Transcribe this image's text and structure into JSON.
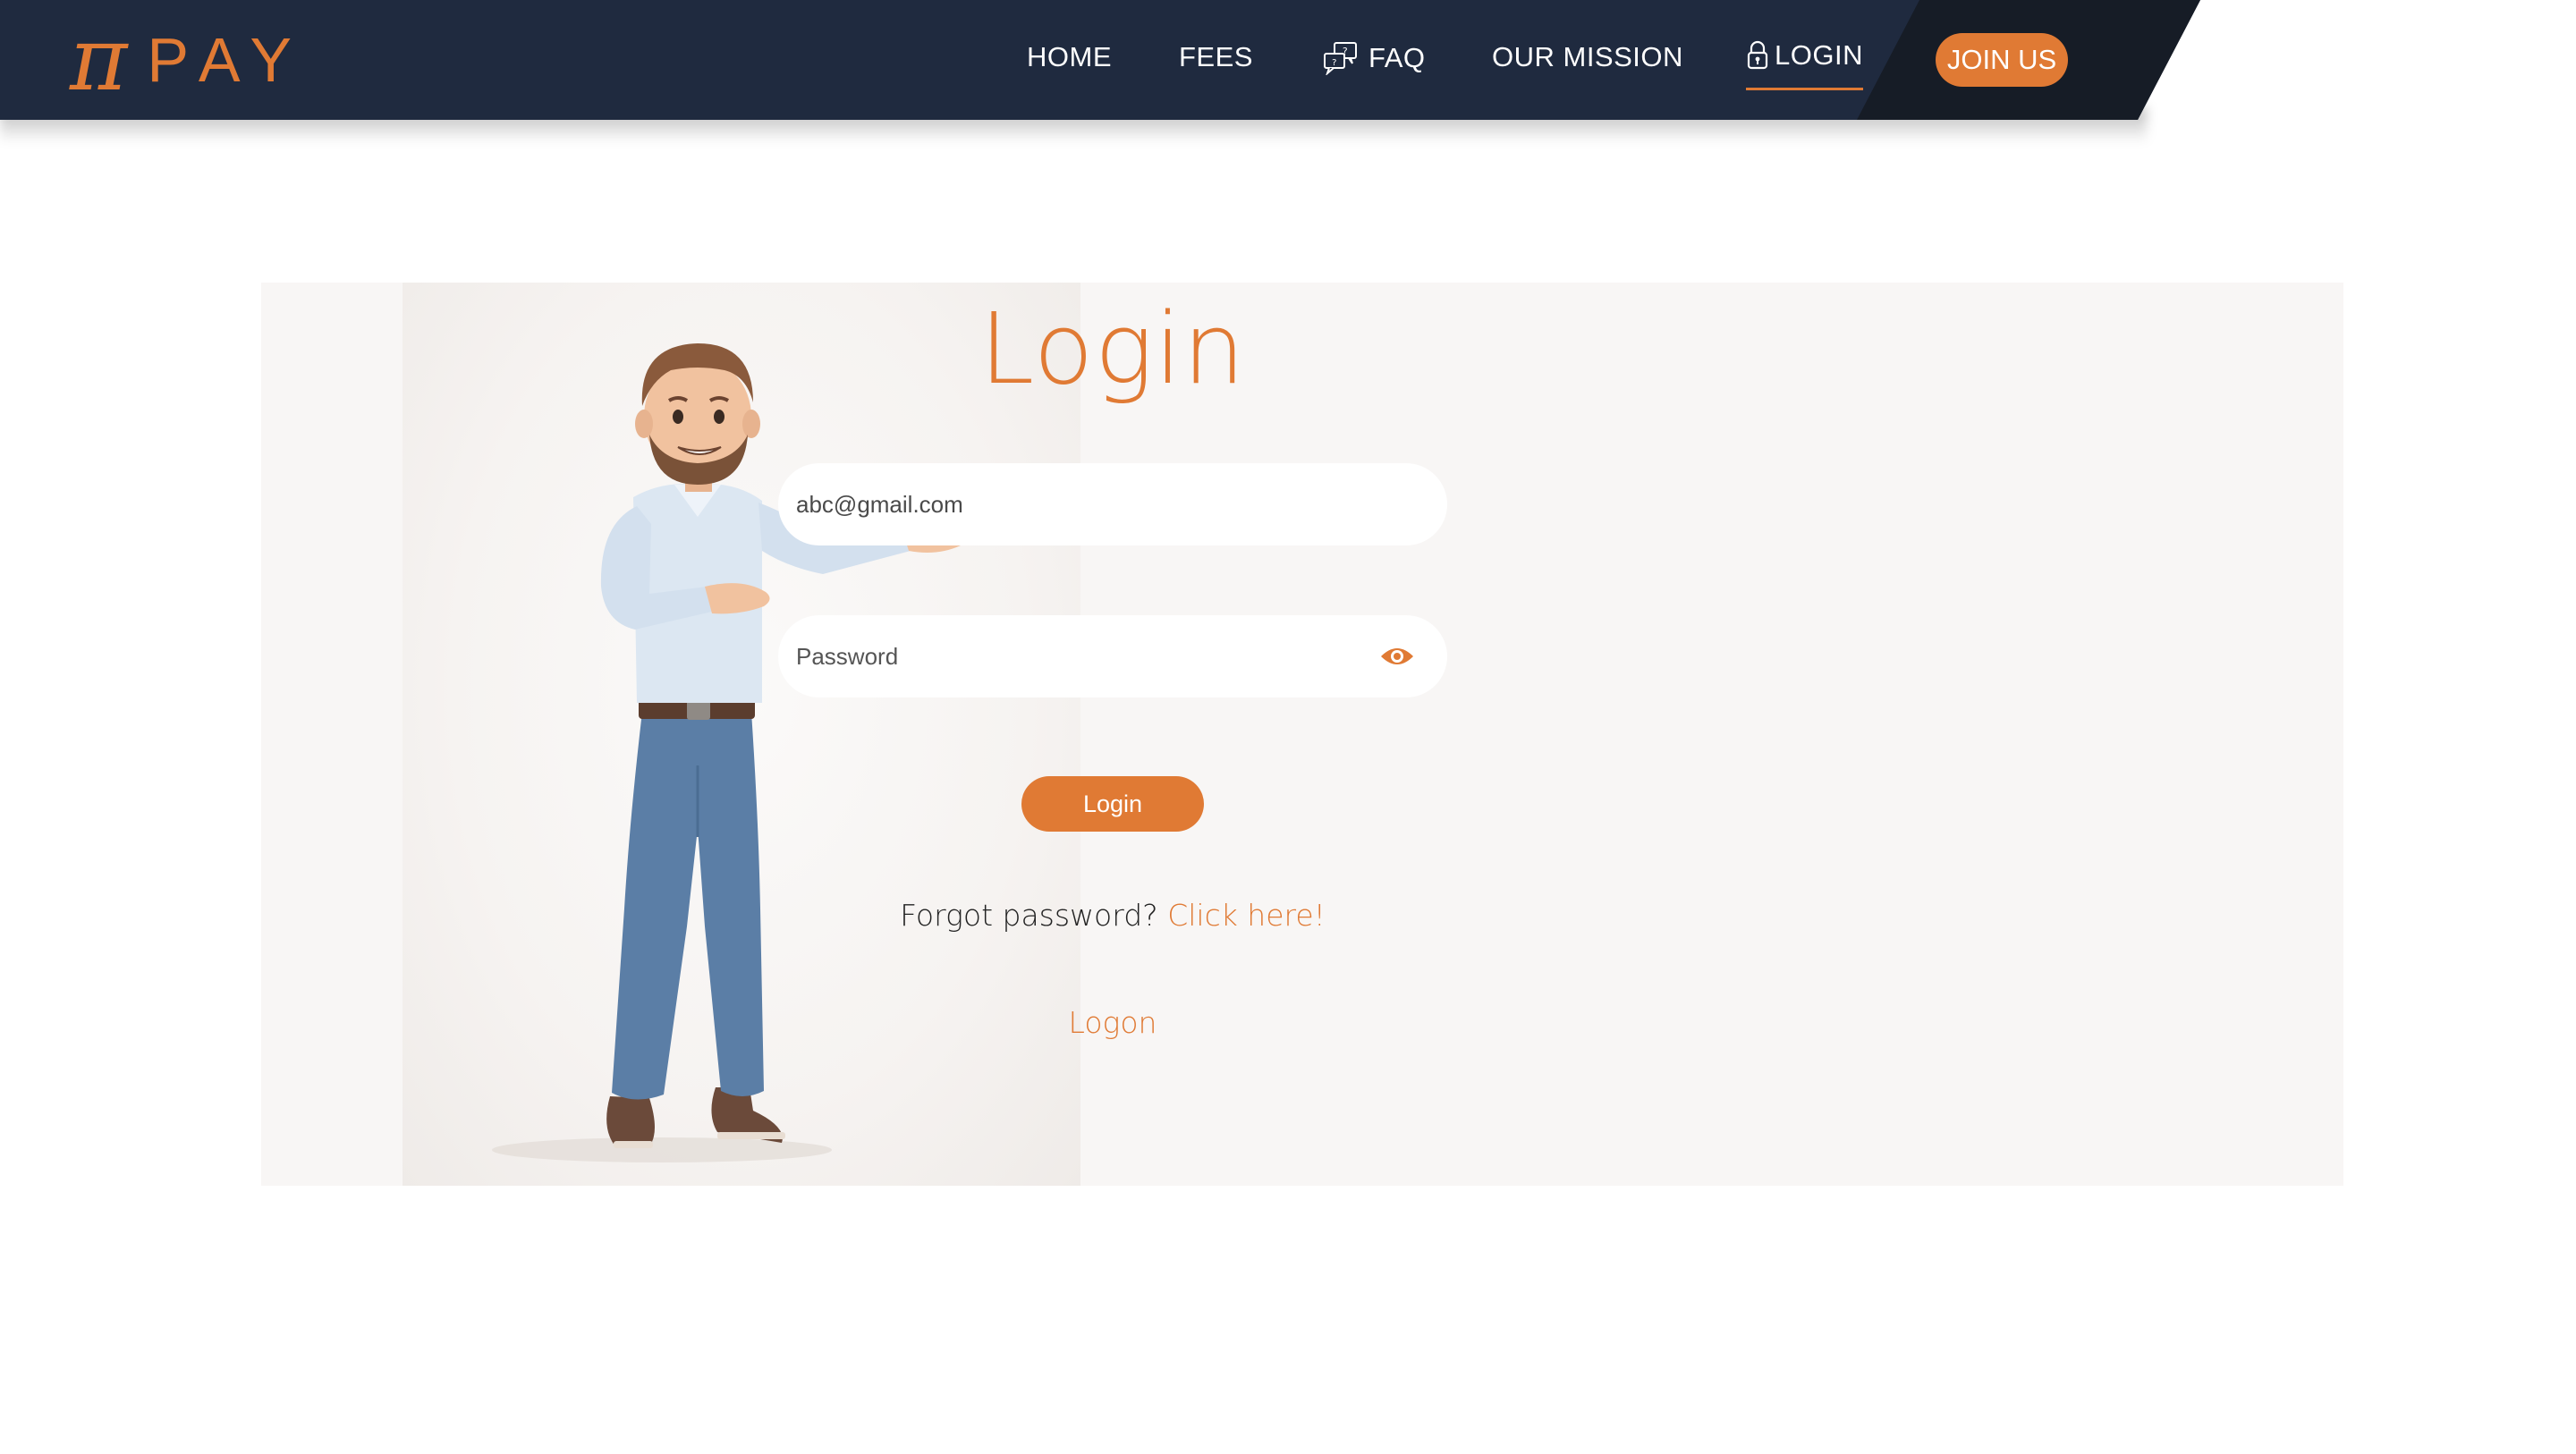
{
  "header": {
    "logo_symbol": "π",
    "logo_text": "PAY",
    "nav": {
      "home": "HOME",
      "fees": "FEES",
      "faq": "FAQ",
      "mission": "OUR MISSION",
      "login": "LOGIN"
    },
    "join_label": "JOIN US"
  },
  "login_form": {
    "title": "Login",
    "email_value": "abc@gmail.com",
    "password_placeholder": "Password",
    "submit_label": "Login",
    "forgot_text": "Forgot password?",
    "forgot_link": "Click here!",
    "logon_link": "Logon"
  },
  "colors": {
    "accent": "#e07a34",
    "header_bg": "#1f2a3f",
    "card_bg": "#f8f6f5"
  },
  "icons": [
    "faq-chat-icon",
    "lock-icon",
    "eye-icon"
  ]
}
